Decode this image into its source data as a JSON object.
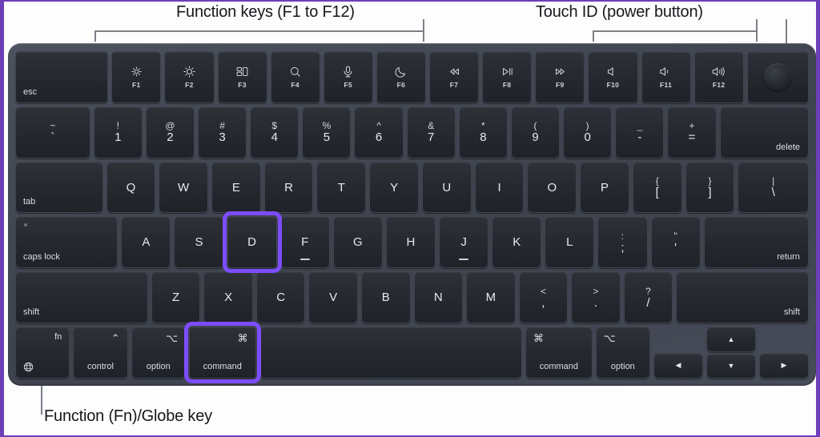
{
  "annotations": {
    "function_keys_label": "Function keys (F1 to F12)",
    "touch_id_label": "Touch ID (power button)",
    "globe_key_label": "Function (Fn)/Globe key"
  },
  "colors": {
    "highlight": "#7c4dff",
    "page_border": "#6d3fb8",
    "chassis": "#454b57",
    "keycap": "#262930",
    "key_text": "#e7e9ee",
    "leader_line": "#7c7f86"
  },
  "highlighted_keys": [
    "D",
    "command"
  ],
  "keyboard": {
    "layout": "Apple MacBook Magic Keyboard (US ANSI)",
    "rows": [
      {
        "name": "function-row",
        "keys": [
          {
            "name": "esc",
            "label": "esc",
            "style": "bottom-left",
            "width": 1.9
          },
          {
            "name": "f1",
            "icon": "brightness-down-icon",
            "fkey": "F1",
            "width": 1
          },
          {
            "name": "f2",
            "icon": "brightness-up-icon",
            "fkey": "F2",
            "width": 1
          },
          {
            "name": "f3",
            "icon": "mission-control-icon",
            "fkey": "F3",
            "width": 1
          },
          {
            "name": "f4",
            "icon": "spotlight-search-icon",
            "fkey": "F4",
            "width": 1
          },
          {
            "name": "f5",
            "icon": "dictation-mic-icon",
            "fkey": "F5",
            "width": 1
          },
          {
            "name": "f6",
            "icon": "do-not-disturb-moon-icon",
            "fkey": "F6",
            "width": 1
          },
          {
            "name": "f7",
            "icon": "rewind-icon",
            "fkey": "F7",
            "width": 1
          },
          {
            "name": "f8",
            "icon": "play-pause-icon",
            "fkey": "F8",
            "width": 1
          },
          {
            "name": "f9",
            "icon": "fast-forward-icon",
            "fkey": "F9",
            "width": 1
          },
          {
            "name": "f10",
            "icon": "volume-mute-icon",
            "fkey": "F10",
            "width": 1
          },
          {
            "name": "f11",
            "icon": "volume-down-icon",
            "fkey": "F11",
            "width": 1
          },
          {
            "name": "f12",
            "icon": "volume-up-icon",
            "fkey": "F12",
            "width": 1
          },
          {
            "name": "touch-id",
            "icon": "touch-id-icon",
            "style": "touchid",
            "width": 1.25
          }
        ]
      },
      {
        "name": "number-row",
        "keys": [
          {
            "name": "backtick",
            "top": "~",
            "bottom": "`",
            "style": "dual",
            "width": 1.55
          },
          {
            "name": "digit-1",
            "top": "!",
            "bottom": "1",
            "style": "dual",
            "width": 1
          },
          {
            "name": "digit-2",
            "top": "@",
            "bottom": "2",
            "style": "dual",
            "width": 1
          },
          {
            "name": "digit-3",
            "top": "#",
            "bottom": "3",
            "style": "dual",
            "width": 1
          },
          {
            "name": "digit-4",
            "top": "$",
            "bottom": "4",
            "style": "dual",
            "width": 1
          },
          {
            "name": "digit-5",
            "top": "%",
            "bottom": "5",
            "style": "dual",
            "width": 1
          },
          {
            "name": "digit-6",
            "top": "^",
            "bottom": "6",
            "style": "dual",
            "width": 1
          },
          {
            "name": "digit-7",
            "top": "&",
            "bottom": "7",
            "style": "dual",
            "width": 1
          },
          {
            "name": "digit-8",
            "top": "*",
            "bottom": "8",
            "style": "dual",
            "width": 1
          },
          {
            "name": "digit-9",
            "top": "(",
            "bottom": "9",
            "style": "dual",
            "width": 1
          },
          {
            "name": "digit-0",
            "top": ")",
            "bottom": "0",
            "style": "dual",
            "width": 1
          },
          {
            "name": "minus",
            "top": "_",
            "bottom": "-",
            "style": "dual",
            "width": 1
          },
          {
            "name": "equals",
            "top": "+",
            "bottom": "=",
            "style": "dual",
            "width": 1
          },
          {
            "name": "delete",
            "label": "delete",
            "style": "bottom-right",
            "width": 1.85
          }
        ]
      },
      {
        "name": "qwerty-row",
        "keys": [
          {
            "name": "tab",
            "label": "tab",
            "style": "bottom-left",
            "width": 1.8
          },
          {
            "name": "key-q",
            "label": "Q",
            "style": "center",
            "width": 1
          },
          {
            "name": "key-w",
            "label": "W",
            "style": "center",
            "width": 1
          },
          {
            "name": "key-e",
            "label": "E",
            "style": "center",
            "width": 1
          },
          {
            "name": "key-r",
            "label": "R",
            "style": "center",
            "width": 1
          },
          {
            "name": "key-t",
            "label": "T",
            "style": "center",
            "width": 1
          },
          {
            "name": "key-y",
            "label": "Y",
            "style": "center",
            "width": 1
          },
          {
            "name": "key-u",
            "label": "U",
            "style": "center",
            "width": 1
          },
          {
            "name": "key-i",
            "label": "I",
            "style": "center",
            "width": 1
          },
          {
            "name": "key-o",
            "label": "O",
            "style": "center",
            "width": 1
          },
          {
            "name": "key-p",
            "label": "P",
            "style": "center",
            "width": 1
          },
          {
            "name": "bracket-left",
            "top": "{",
            "bottom": "[",
            "style": "dual",
            "width": 1
          },
          {
            "name": "bracket-right",
            "top": "}",
            "bottom": "]",
            "style": "dual",
            "width": 1
          },
          {
            "name": "backslash",
            "top": "|",
            "bottom": "\\",
            "style": "dual",
            "width": 1.45
          }
        ]
      },
      {
        "name": "home-row",
        "keys": [
          {
            "name": "caps-lock",
            "label": "caps lock",
            "style": "bottom-left",
            "width": 2.1,
            "led": true
          },
          {
            "name": "key-a",
            "label": "A",
            "style": "center",
            "width": 1
          },
          {
            "name": "key-s",
            "label": "S",
            "style": "center",
            "width": 1
          },
          {
            "name": "key-d",
            "label": "D",
            "style": "center",
            "width": 1,
            "highlight": true
          },
          {
            "name": "key-f",
            "label": "F",
            "style": "center",
            "width": 1,
            "homing": true
          },
          {
            "name": "key-g",
            "label": "G",
            "style": "center",
            "width": 1
          },
          {
            "name": "key-h",
            "label": "H",
            "style": "center",
            "width": 1
          },
          {
            "name": "key-j",
            "label": "J",
            "style": "center",
            "width": 1,
            "homing": true
          },
          {
            "name": "key-k",
            "label": "K",
            "style": "center",
            "width": 1
          },
          {
            "name": "key-l",
            "label": "L",
            "style": "center",
            "width": 1
          },
          {
            "name": "semicolon",
            "top": ":",
            "bottom": ";",
            "style": "dual",
            "width": 1
          },
          {
            "name": "quote",
            "top": "\"",
            "bottom": "'",
            "style": "dual",
            "width": 1
          },
          {
            "name": "return",
            "label": "return",
            "style": "bottom-right",
            "width": 2.15
          }
        ]
      },
      {
        "name": "shift-row",
        "keys": [
          {
            "name": "shift-left",
            "label": "shift",
            "style": "bottom-left",
            "width": 2.75
          },
          {
            "name": "key-z",
            "label": "Z",
            "style": "center",
            "width": 1
          },
          {
            "name": "key-x",
            "label": "X",
            "style": "center",
            "width": 1
          },
          {
            "name": "key-c",
            "label": "C",
            "style": "center",
            "width": 1
          },
          {
            "name": "key-v",
            "label": "V",
            "style": "center",
            "width": 1
          },
          {
            "name": "key-b",
            "label": "B",
            "style": "center",
            "width": 1
          },
          {
            "name": "key-n",
            "label": "N",
            "style": "center",
            "width": 1
          },
          {
            "name": "key-m",
            "label": "M",
            "style": "center",
            "width": 1
          },
          {
            "name": "comma",
            "top": "<",
            "bottom": ",",
            "style": "dual",
            "width": 1
          },
          {
            "name": "period",
            "top": ">",
            "bottom": ".",
            "style": "dual",
            "width": 1
          },
          {
            "name": "slash",
            "top": "?",
            "bottom": "/",
            "style": "dual",
            "width": 1
          },
          {
            "name": "shift-right",
            "label": "shift",
            "style": "bottom-right",
            "width": 2.75
          }
        ]
      },
      {
        "name": "bottom-row",
        "keys": [
          {
            "name": "fn-globe",
            "label": "fn",
            "icon": "globe-icon",
            "style": "fnglobe",
            "width": 1.3
          },
          {
            "name": "control",
            "label": "control",
            "symbol": "⌃",
            "style": "modifier",
            "width": 1.3
          },
          {
            "name": "option-left",
            "label": "option",
            "symbol": "⌥",
            "style": "modifier",
            "width": 1.3
          },
          {
            "name": "command-left",
            "label": "command",
            "symbol": "⌘",
            "style": "modifier",
            "width": 1.6,
            "highlight": true
          },
          {
            "name": "space",
            "label": "",
            "style": "center",
            "width": 6.4
          },
          {
            "name": "command-right",
            "label": "command",
            "symbol": "⌘",
            "style": "modifier-left",
            "width": 1.6
          },
          {
            "name": "option-right",
            "label": "option",
            "symbol": "⌥",
            "style": "modifier-left",
            "width": 1.3
          }
        ],
        "arrows": {
          "left": {
            "name": "arrow-left-key",
            "glyph": "◀"
          },
          "up": {
            "name": "arrow-up-key",
            "glyph": "▲"
          },
          "down": {
            "name": "arrow-down-key",
            "glyph": "▼"
          },
          "right": {
            "name": "arrow-right-key",
            "glyph": "▶"
          }
        }
      }
    ]
  }
}
